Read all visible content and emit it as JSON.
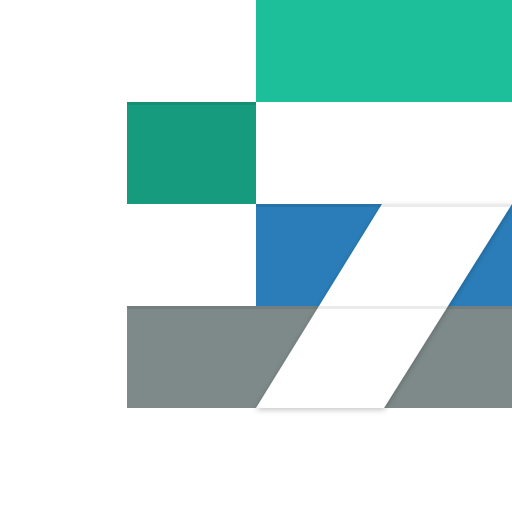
{
  "logo": {
    "colors": {
      "background": "#ffffff",
      "top_teal": "#1dbf9b",
      "dark_teal": "#169b7f",
      "blue": "#2a7db9",
      "gray": "#7d8a89",
      "cut_white": "#ffffff"
    }
  }
}
